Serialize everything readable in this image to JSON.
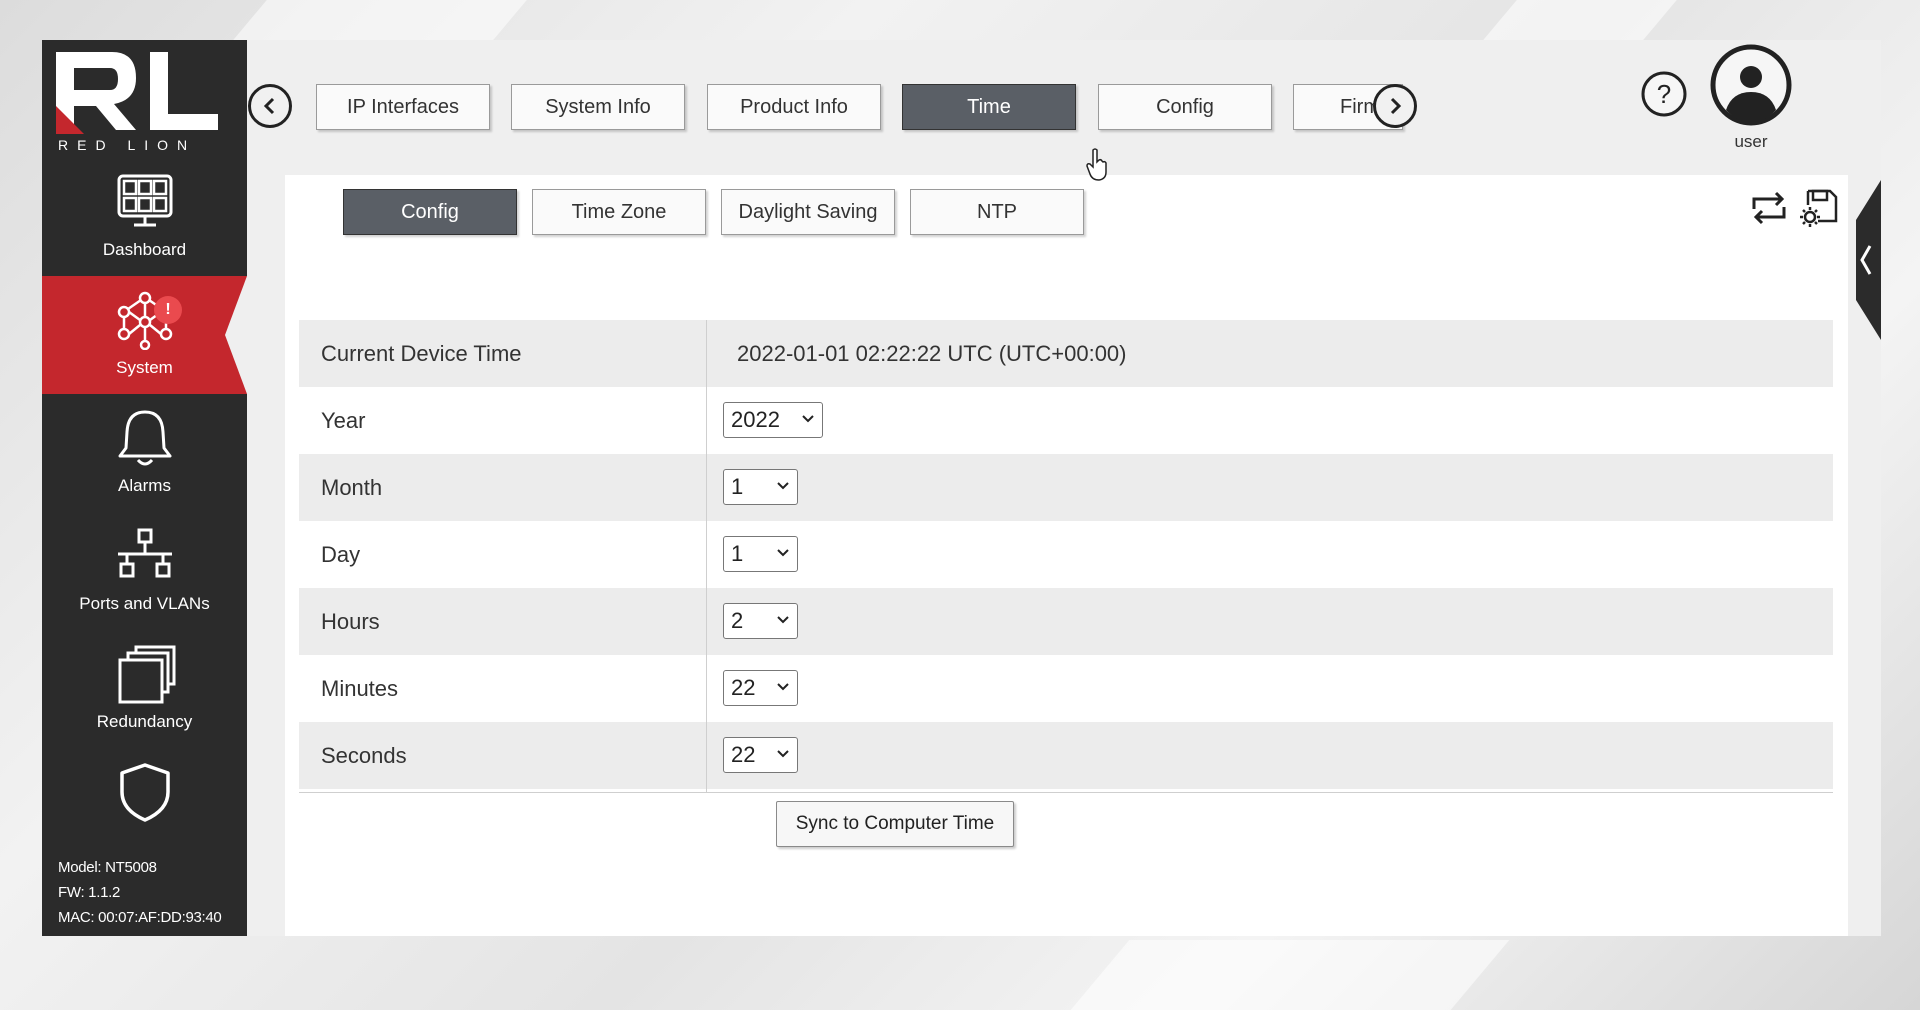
{
  "brand": {
    "logo_text": "RL",
    "tagline": "RED LION"
  },
  "sidebar": {
    "items": [
      {
        "label": "Dashboard",
        "icon": "dashboard-icon"
      },
      {
        "label": "System",
        "icon": "network-icon",
        "badge": "!",
        "active": true
      },
      {
        "label": "Alarms",
        "icon": "bell-icon"
      },
      {
        "label": "Ports and VLANs",
        "icon": "ports-icon"
      },
      {
        "label": "Redundancy",
        "icon": "redundancy-icon"
      },
      {
        "label": "",
        "icon": "shield-icon"
      }
    ],
    "device": {
      "model": "Model: NT5008",
      "fw": "FW: 1.1.2",
      "mac": "MAC: 00:07:AF:DD:93:40"
    }
  },
  "top_tabs": {
    "items": [
      "IP Interfaces",
      "System Info",
      "Product Info",
      "Time",
      "Config",
      "Firm"
    ],
    "active": "Time"
  },
  "header": {
    "user_label": "user"
  },
  "sub_tabs": {
    "items": [
      "Config",
      "Time Zone",
      "Daylight Saving",
      "NTP"
    ],
    "active": "Config"
  },
  "time_config": {
    "current_label": "Current Device Time",
    "current_value": "2022-01-01 02:22:22 UTC (UTC+00:00)",
    "fields": [
      {
        "label": "Year",
        "value": "2022"
      },
      {
        "label": "Month",
        "value": "1"
      },
      {
        "label": "Day",
        "value": "1"
      },
      {
        "label": "Hours",
        "value": "2"
      },
      {
        "label": "Minutes",
        "value": "22"
      },
      {
        "label": "Seconds",
        "value": "22"
      }
    ],
    "sync_label": "Sync to Computer Time"
  },
  "colors": {
    "sidebar_bg": "#2b2b2b",
    "accent_red": "#c4272d",
    "active_tab": "#5a5f66",
    "badge": "#ea4a4e"
  }
}
